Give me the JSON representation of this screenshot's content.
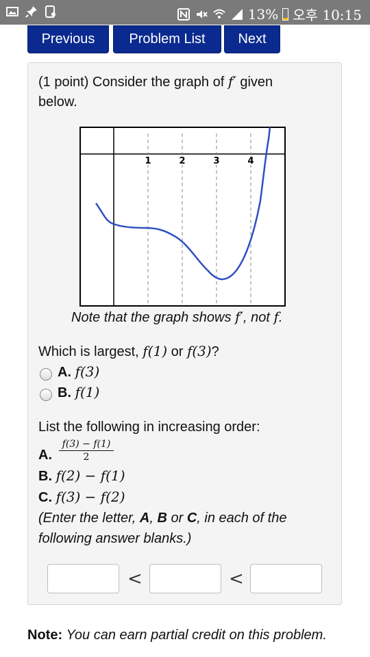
{
  "status_bar": {
    "battery": "13%",
    "time": "오후 10:15",
    "battery_level": 0.13,
    "icons": [
      "image-icon",
      "pin-icon",
      "nfc-icon",
      "mute-icon",
      "wifi-icon",
      "signal-icon",
      "battery-icon"
    ]
  },
  "nav": {
    "previous": "Previous",
    "problem_list": "Problem List",
    "next": "Next",
    "color": "#0b2a8f"
  },
  "problem": {
    "prompt_prefix": "(1 point) Consider the graph of",
    "prompt_fprime": "f′",
    "prompt_suffix": "given",
    "prompt_line2": "below.",
    "graph": {
      "x_ticks": [
        "1",
        "2",
        "3",
        "4"
      ],
      "note_prefix": "Note that the graph shows",
      "note_fprime": "f′",
      "note_mid": ", not",
      "note_f": "f",
      "note_end": "."
    },
    "q1": {
      "text_prefix": "Which is largest,",
      "expr1": "f(1)",
      "or": "or",
      "expr2": "f(3)",
      "qmark": "?",
      "options": [
        {
          "letter": "A.",
          "expr": "f(3)"
        },
        {
          "letter": "B.",
          "expr": "f(1)"
        }
      ]
    },
    "q2": {
      "text": "List the following in increasing order:",
      "items": [
        {
          "letter": "A.",
          "numerator": "f(3) − f(1)",
          "denominator": "2"
        },
        {
          "letter": "B.",
          "expr": "f(2) − f(1)"
        },
        {
          "letter": "C.",
          "expr": "f(3) − f(2)"
        }
      ],
      "instr_1": "(Enter the letter,",
      "instr_a": "A",
      "instr_comma": ",",
      "instr_b": "B",
      "instr_or": "or",
      "instr_c": "C",
      "instr_2": ", in each of the",
      "instr_line2": "following answer blanks.)",
      "lt1": "<",
      "lt2": "<",
      "answers": [
        "",
        "",
        ""
      ]
    }
  },
  "footer": {
    "note_label": "Note:",
    "note_text": "You can earn partial credit on this problem."
  }
}
